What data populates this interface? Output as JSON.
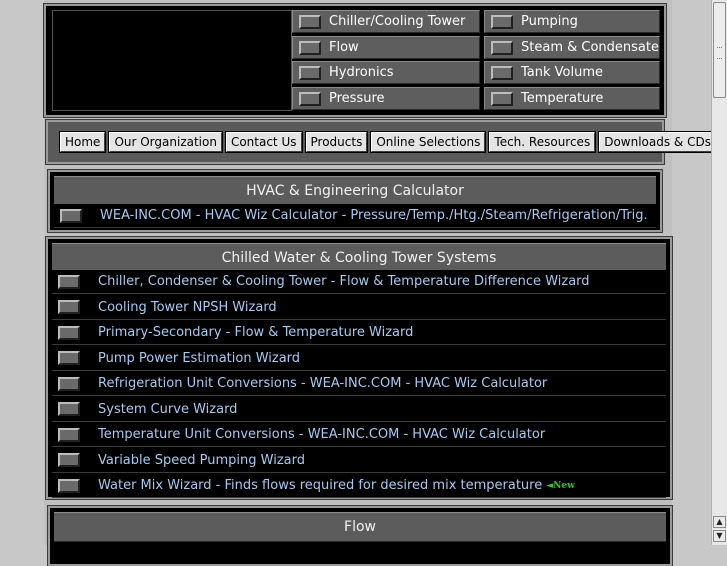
{
  "categories": [
    {
      "label": "Chiller/Cooling Tower"
    },
    {
      "label": "Pumping"
    },
    {
      "label": "Flow"
    },
    {
      "label": "Steam & Condensate"
    },
    {
      "label": "Hydronics"
    },
    {
      "label": "Tank Volume"
    },
    {
      "label": "Pressure"
    },
    {
      "label": "Temperature"
    }
  ],
  "nav": [
    {
      "label": "Home"
    },
    {
      "label": "Our Organization"
    },
    {
      "label": "Contact Us"
    },
    {
      "label": "Products"
    },
    {
      "label": "Online Selections"
    },
    {
      "label": "Tech. Resources"
    },
    {
      "label": "Downloads & CDs"
    }
  ],
  "hvac": {
    "title": "HVAC & Engineering Calculator",
    "items": [
      {
        "label": "WEA-INC.COM - HVAC Wiz Calculator - Pressure/Temp./Htg./Steam/Refrigeration/Trig."
      }
    ]
  },
  "chilled": {
    "title": "Chilled Water & Cooling Tower Systems",
    "items": [
      {
        "label": "Chiller, Condenser & Cooling Tower   - Flow & Temperature Difference Wizard"
      },
      {
        "label": "Cooling Tower NPSH Wizard"
      },
      {
        "label": "Primary-Secondary - Flow & Temperature  Wizard"
      },
      {
        "label": "Pump Power Estimation Wizard"
      },
      {
        "label": "Refrigeration Unit  Conversions - WEA-INC.COM - HVAC Wiz Calculator"
      },
      {
        "label": "System Curve Wizard"
      },
      {
        "label": "Temperature Unit  Conversions - WEA-INC.COM -  HVAC Wiz Calculator"
      },
      {
        "label": "Variable Speed  Pumping Wizard"
      },
      {
        "label": "Water Mix Wizard - Finds flows required for desired mix temperature",
        "badge": "New"
      }
    ]
  },
  "flow": {
    "title": "Flow"
  }
}
